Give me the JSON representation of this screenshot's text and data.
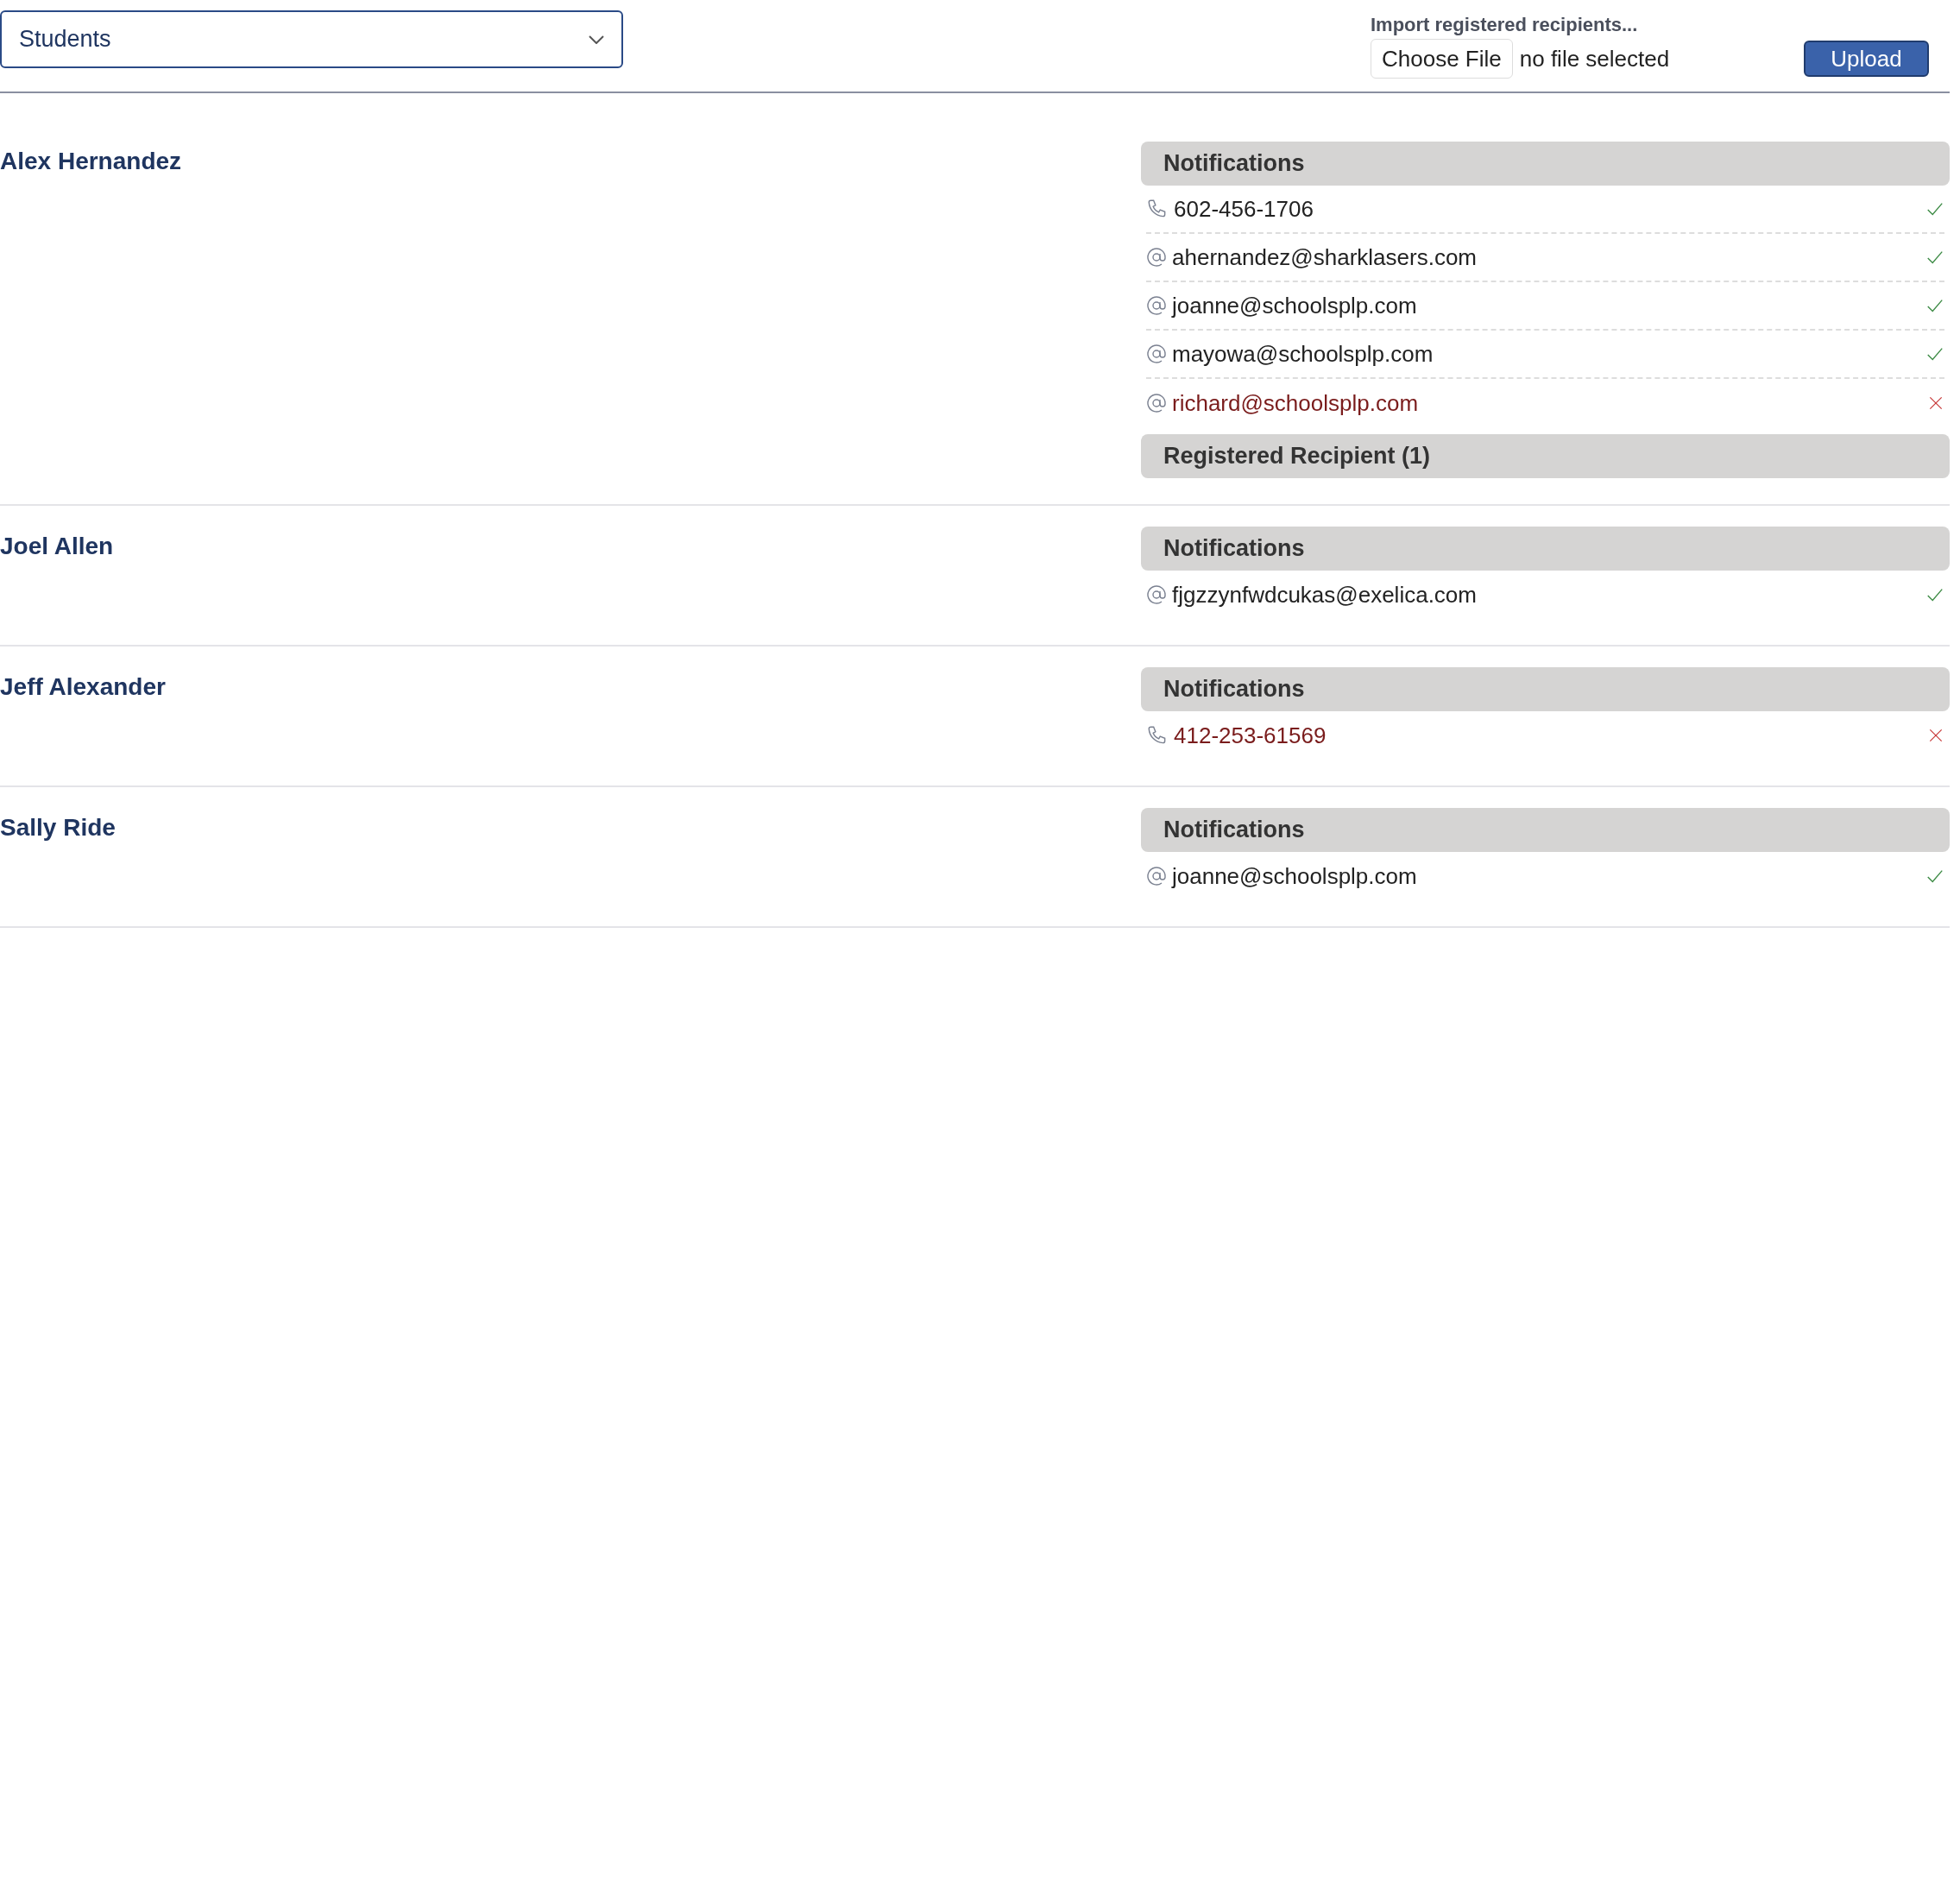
{
  "filter": {
    "value": "Students"
  },
  "import": {
    "label": "Import registered recipients...",
    "choose_button": "Choose File",
    "file_status": "no file selected",
    "upload_button": "Upload"
  },
  "students": [
    {
      "name": "Alex Hernandez",
      "sections": [
        {
          "title": "Notifications",
          "items": [
            {
              "kind": "phone",
              "value": "602-456-1706",
              "ok": true
            },
            {
              "kind": "email",
              "value": "ahernandez@sharklasers.com",
              "ok": true
            },
            {
              "kind": "email",
              "value": "joanne@schoolsplp.com",
              "ok": true
            },
            {
              "kind": "email",
              "value": "mayowa@schoolsplp.com",
              "ok": true
            },
            {
              "kind": "email",
              "value": "richard@schoolsplp.com",
              "ok": false
            }
          ]
        },
        {
          "title": "Registered Recipient (1)"
        }
      ]
    },
    {
      "name": "Joel Allen",
      "sections": [
        {
          "title": "Notifications",
          "items": [
            {
              "kind": "email",
              "value": "fjgzzynfwdcukas@exelica.com",
              "ok": true
            }
          ]
        }
      ]
    },
    {
      "name": "Jeff Alexander",
      "sections": [
        {
          "title": "Notifications",
          "items": [
            {
              "kind": "phone",
              "value": "412-253-61569",
              "ok": false
            }
          ]
        }
      ]
    },
    {
      "name": "Sally Ride",
      "sections": [
        {
          "title": "Notifications",
          "items": [
            {
              "kind": "email",
              "value": "joanne@schoolsplp.com",
              "ok": true
            }
          ]
        }
      ]
    }
  ]
}
